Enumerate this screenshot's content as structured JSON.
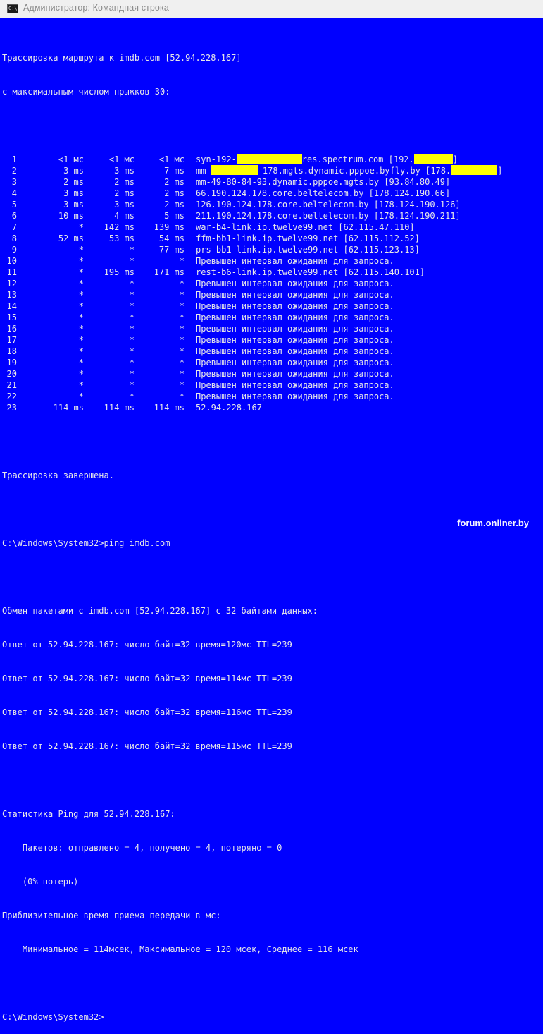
{
  "window": {
    "title": "Администратор: Командная строка",
    "icon": "cmd-icon",
    "icon_text": "C:\\"
  },
  "traceroute": {
    "header1": "Трассировка маршрута к imdb.com [52.94.228.167]",
    "header2": "с максимальным числом прыжков 30:",
    "hops": [
      {
        "n": "1",
        "r1": "<1 мс",
        "r2": "<1 мс",
        "r3": "<1 мс",
        "host": "",
        "redacted": true
      },
      {
        "n": "2",
        "r1": "3 ms",
        "r2": "3 ms",
        "r3": "7 ms",
        "host": "",
        "redacted": true
      },
      {
        "n": "3",
        "r1": "2 ms",
        "r2": "2 ms",
        "r3": "2 ms",
        "host": "mm-49-80-84-93.dynamic.pppoe.mgts.by [93.84.80.49]"
      },
      {
        "n": "4",
        "r1": "3 ms",
        "r2": "2 ms",
        "r3": "2 ms",
        "host": "66.190.124.178.core.beltelecom.by [178.124.190.66]"
      },
      {
        "n": "5",
        "r1": "3 ms",
        "r2": "3 ms",
        "r3": "2 ms",
        "host": "126.190.124.178.core.beltelecom.by [178.124.190.126]"
      },
      {
        "n": "6",
        "r1": "10 ms",
        "r2": "4 ms",
        "r3": "5 ms",
        "host": "211.190.124.178.core.beltelecom.by [178.124.190.211]"
      },
      {
        "n": "7",
        "r1": "*",
        "r2": "142 ms",
        "r3": "139 ms",
        "host": "war-b4-link.ip.twelve99.net [62.115.47.110]"
      },
      {
        "n": "8",
        "r1": "52 ms",
        "r2": "53 ms",
        "r3": "54 ms",
        "host": "ffm-bb1-link.ip.twelve99.net [62.115.112.52]"
      },
      {
        "n": "9",
        "r1": "*",
        "r2": "*",
        "r3": "77 ms",
        "host": "prs-bb1-link.ip.twelve99.net [62.115.123.13]"
      },
      {
        "n": "10",
        "r1": "*",
        "r2": "*",
        "r3": "*",
        "host": "Превышен интервал ожидания для запроса."
      },
      {
        "n": "11",
        "r1": "*",
        "r2": "195 ms",
        "r3": "171 ms",
        "host": "rest-b6-link.ip.twelve99.net [62.115.140.101]"
      },
      {
        "n": "12",
        "r1": "*",
        "r2": "*",
        "r3": "*",
        "host": "Превышен интервал ожидания для запроса."
      },
      {
        "n": "13",
        "r1": "*",
        "r2": "*",
        "r3": "*",
        "host": "Превышен интервал ожидания для запроса."
      },
      {
        "n": "14",
        "r1": "*",
        "r2": "*",
        "r3": "*",
        "host": "Превышен интервал ожидания для запроса."
      },
      {
        "n": "15",
        "r1": "*",
        "r2": "*",
        "r3": "*",
        "host": "Превышен интервал ожидания для запроса."
      },
      {
        "n": "16",
        "r1": "*",
        "r2": "*",
        "r3": "*",
        "host": "Превышен интервал ожидания для запроса."
      },
      {
        "n": "17",
        "r1": "*",
        "r2": "*",
        "r3": "*",
        "host": "Превышен интервал ожидания для запроса."
      },
      {
        "n": "18",
        "r1": "*",
        "r2": "*",
        "r3": "*",
        "host": "Превышен интервал ожидания для запроса."
      },
      {
        "n": "19",
        "r1": "*",
        "r2": "*",
        "r3": "*",
        "host": "Превышен интервал ожидания для запроса."
      },
      {
        "n": "20",
        "r1": "*",
        "r2": "*",
        "r3": "*",
        "host": "Превышен интервал ожидания для запроса."
      },
      {
        "n": "21",
        "r1": "*",
        "r2": "*",
        "r3": "*",
        "host": "Превышен интервал ожидания для запроса."
      },
      {
        "n": "22",
        "r1": "*",
        "r2": "*",
        "r3": "*",
        "host": "Превышен интервал ожидания для запроса."
      },
      {
        "n": "23",
        "r1": "114 ms",
        "r2": "114 ms",
        "r3": "114 ms",
        "host": "52.94.228.167"
      }
    ],
    "hop1_parts": {
      "a": "syn-192-",
      "b": "res.spectrum.com [192.",
      "c": "]"
    },
    "hop2_parts": {
      "a": "mm-",
      "b": "-178.mgts.dynamic.pppoe.byfly.by [178.",
      "c": "]"
    },
    "done": "Трассировка завершена."
  },
  "ping": {
    "command": "C:\\Windows\\System32>ping imdb.com",
    "exchange": "Обмен пакетами с imdb.com [52.94.228.167] с 32 байтами данных:",
    "replies": [
      "Ответ от 52.94.228.167: число байт=32 время=120мс TTL=239",
      "Ответ от 52.94.228.167: число байт=32 время=114мс TTL=239",
      "Ответ от 52.94.228.167: число байт=32 время=116мс TTL=239",
      "Ответ от 52.94.228.167: число байт=32 время=115мс TTL=239"
    ],
    "stats_title": "Статистика Ping для 52.94.228.167:",
    "packets": "    Пакетов: отправлено = 4, получено = 4, потеряно = 0",
    "loss": "    (0% потерь)",
    "rtt_title": "Приблизительное время приема-передачи в мс:",
    "rtt_values": "    Минимальное = 114мсек, Максимальное = 120 мсек, Среднее = 116 мсек"
  },
  "prompt": "C:\\Windows\\System32>",
  "watermark": "forum.onliner.by",
  "colors": {
    "background": "#0000ff",
    "text": "#e8e8e8",
    "redaction": "#ffff00"
  }
}
